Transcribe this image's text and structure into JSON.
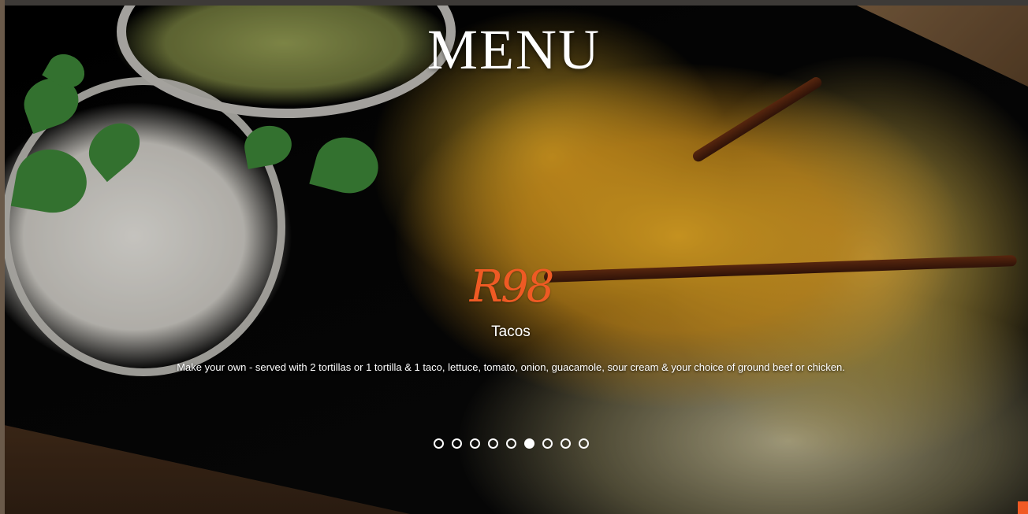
{
  "slider": {
    "title": "MENU",
    "price": "R98",
    "item_name": "Tacos",
    "description": "Make your own - served with 2 tortillas or 1 tortilla & 1 taco, lettuce, tomato, onion, guacamole, sour cream & your choice of ground beef or chicken.",
    "dot_count": 9,
    "active_dot": 6,
    "price_color": "#ef5a24",
    "accent_color": "#f15a24"
  }
}
